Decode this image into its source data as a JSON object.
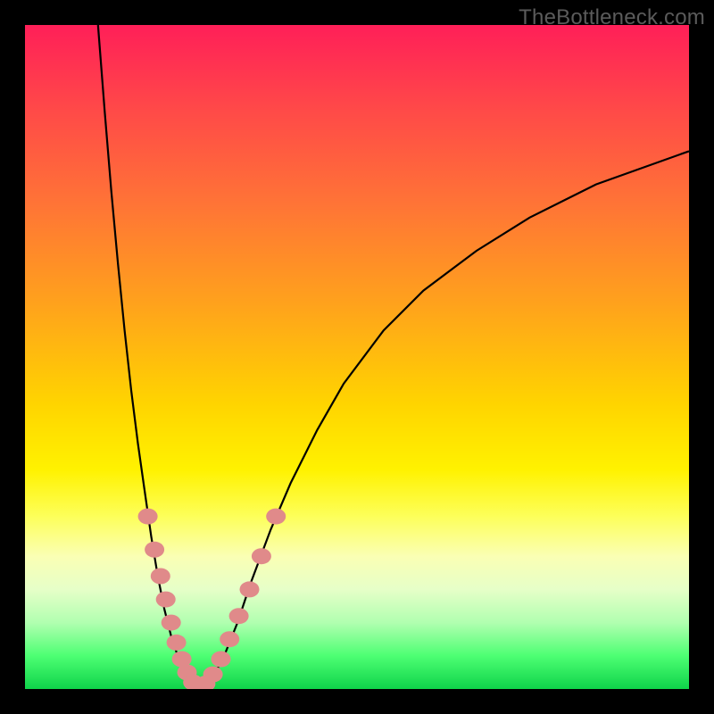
{
  "watermark": "TheBottleneck.com",
  "colors": {
    "frame": "#000000",
    "curve": "#000000",
    "marker_fill": "#e08a8a",
    "marker_stroke": "#c96f6f"
  },
  "chart_data": {
    "type": "line",
    "title": "",
    "xlabel": "",
    "ylabel": "",
    "xlim": [
      0,
      100
    ],
    "ylim": [
      0,
      100
    ],
    "legend": false,
    "grid": false,
    "series": [
      {
        "name": "bottleneck-curve",
        "x": [
          11,
          12,
          13,
          14,
          15,
          16,
          17,
          18,
          19,
          20,
          21,
          22,
          23,
          24,
          25,
          26,
          27,
          28,
          30,
          32,
          34,
          37,
          40,
          44,
          48,
          54,
          60,
          68,
          76,
          86,
          100
        ],
        "y": [
          100,
          87,
          75,
          64,
          54,
          45,
          37,
          30,
          23,
          17,
          12,
          8,
          5,
          2.5,
          1,
          0.3,
          0.3,
          1.2,
          5,
          10,
          16,
          24,
          31,
          39,
          46,
          54,
          60,
          66,
          71,
          76,
          81
        ]
      }
    ],
    "markers": [
      {
        "x": 18.5,
        "y": 26
      },
      {
        "x": 19.5,
        "y": 21
      },
      {
        "x": 20.4,
        "y": 17
      },
      {
        "x": 21.2,
        "y": 13.5
      },
      {
        "x": 22.0,
        "y": 10
      },
      {
        "x": 22.8,
        "y": 7
      },
      {
        "x": 23.6,
        "y": 4.5
      },
      {
        "x": 24.4,
        "y": 2.5
      },
      {
        "x": 25.3,
        "y": 1
      },
      {
        "x": 26.2,
        "y": 0.5
      },
      {
        "x": 27.2,
        "y": 0.8
      },
      {
        "x": 28.3,
        "y": 2.2
      },
      {
        "x": 29.5,
        "y": 4.5
      },
      {
        "x": 30.8,
        "y": 7.5
      },
      {
        "x": 32.2,
        "y": 11
      },
      {
        "x": 33.8,
        "y": 15
      },
      {
        "x": 35.6,
        "y": 20
      },
      {
        "x": 37.8,
        "y": 26
      }
    ]
  }
}
